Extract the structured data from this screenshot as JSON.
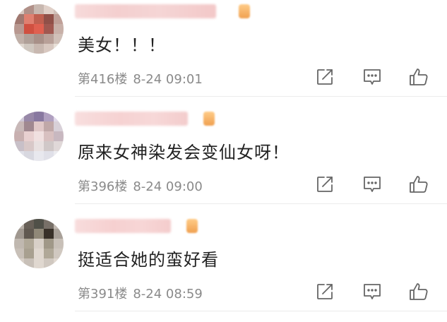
{
  "comments": [
    {
      "text": "美女！！！",
      "floor": "第416楼",
      "time": "8-24 09:01",
      "avatar_colors": [
        "#d8c8c0",
        "#b09088",
        "#c8b8b0",
        "#e0d0c8",
        "#d0c0b8",
        "#a07870",
        "#e08070",
        "#c06050",
        "#905048",
        "#c0a098",
        "#b89890",
        "#d05040",
        "#e06050",
        "#a05850",
        "#c8b0a8",
        "#c0b0a8",
        "#b0a098",
        "#a89088",
        "#b8a098",
        "#d0c0b8",
        "#e0d8d0",
        "#d0c8c0",
        "#c8b8b0",
        "#d8c8c0",
        "#e8e0d8"
      ]
    },
    {
      "text": "原来女神染发会变仙女呀！",
      "floor": "第396楼",
      "time": "8-24 09:00",
      "avatar_colors": [
        "#d0c8d8",
        "#9888a8",
        "#8878a0",
        "#b0a0c0",
        "#e0d8e8",
        "#c8b8b8",
        "#a08890",
        "#e0c8c8",
        "#c0a8a8",
        "#d8d0d8",
        "#c8b0b0",
        "#e8d0d0",
        "#f0e0e0",
        "#d8c0c0",
        "#c8b8c0",
        "#c8c0c8",
        "#d8c8c8",
        "#e8e0e0",
        "#d0c8c8",
        "#e0d8d8",
        "#e0e0e8",
        "#d8d8e0",
        "#e8e8ee",
        "#e0e0e8",
        "#ececf0"
      ]
    },
    {
      "text": "挺适合她的蛮好看",
      "floor": "第391楼",
      "time": "8-24 08:59",
      "avatar_colors": [
        "#b8b0a8",
        "#686058",
        "#505048",
        "#787068",
        "#c0b8b0",
        "#a09890",
        "#605850",
        "#908878",
        "#383028",
        "#a8a098",
        "#c0b8b0",
        "#b0a898",
        "#d8d0c8",
        "#a09888",
        "#c8c0b8",
        "#c8c0b8",
        "#a8a090",
        "#e0d8d0",
        "#b0a898",
        "#d0c8c0",
        "#d8d0c8",
        "#c8c0b8",
        "#e0d8d0",
        "#d0c8c0",
        "#e0d8d0"
      ]
    }
  ]
}
